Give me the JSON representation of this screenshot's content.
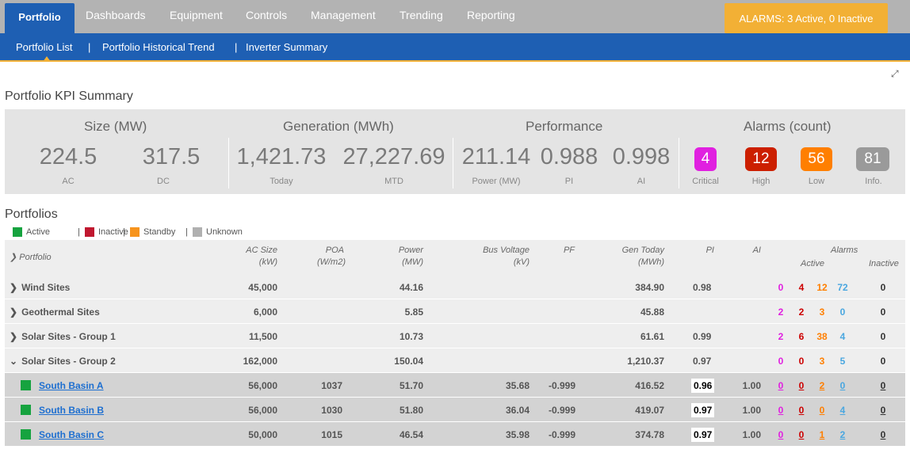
{
  "nav": {
    "tabs": [
      "Portfolio",
      "Dashboards",
      "Equipment",
      "Controls",
      "Management",
      "Trending",
      "Reporting"
    ],
    "alarms": "ALARMS: 3 Active, 0 Inactive"
  },
  "subnav": {
    "items": [
      "Portfolio List",
      "Portfolio Historical Trend",
      "Inverter Summary"
    ],
    "separator": "|"
  },
  "kpi": {
    "title": "Portfolio KPI Summary",
    "groups": {
      "size": "Size (MW)",
      "generation": "Generation (MWh)",
      "performance": "Performance",
      "alarms": "Alarms (count)"
    },
    "values": [
      {
        "value": "224.5",
        "label": "AC"
      },
      {
        "value": "317.5",
        "label": "DC"
      },
      {
        "value": "1,421.73",
        "label": "Today"
      },
      {
        "value": "27,227.69",
        "label": "MTD"
      },
      {
        "value": "211.14",
        "label": "Power (MW)"
      },
      {
        "value": "0.988",
        "label": "PI"
      },
      {
        "value": "0.998",
        "label": "AI"
      }
    ],
    "alarms": [
      {
        "value": "4",
        "label": "Critical",
        "color": "#e020e0"
      },
      {
        "value": "12",
        "label": "High",
        "color": "#cc1f00"
      },
      {
        "value": "56",
        "label": "Low",
        "color": "#ff7f00"
      },
      {
        "value": "81",
        "label": "Info.",
        "color": "#9a9a9a"
      }
    ]
  },
  "portfolios": {
    "title": "Portfolios",
    "legend": [
      {
        "label": "Active",
        "color": "#16a33f"
      },
      {
        "label": "Inactive",
        "color": "#c0172f"
      },
      {
        "label": "Standby",
        "color": "#f7941d"
      },
      {
        "label": "Unknown",
        "color": "#b0b0b0"
      }
    ],
    "legend_sep": "|",
    "headers": {
      "portfolio": "Portfolio",
      "ac_size": "AC Size",
      "ac_size_unit": "(kW)",
      "poa": "POA",
      "poa_unit": "(W/m2)",
      "power": "Power",
      "power_unit": "(MW)",
      "bus_voltage": "Bus Voltage",
      "bus_voltage_unit": "(kV)",
      "pf": "PF",
      "gen_today": "Gen Today",
      "gen_today_unit": "(MWh)",
      "pi": "PI",
      "ai": "AI",
      "alarms": "Alarms",
      "active": "Active",
      "inactive": "Inactive"
    },
    "rows": [
      {
        "name": "Wind Sites",
        "ac": "45,000",
        "poa": "",
        "power": "44.16",
        "bv": "",
        "pf": "",
        "gen": "384.90",
        "pi": "0.98",
        "ai": "",
        "crit": "0",
        "high": "4",
        "low": "12",
        "info": "72",
        "inactive": "0"
      },
      {
        "name": "Geothermal Sites",
        "ac": "6,000",
        "poa": "",
        "power": "5.85",
        "bv": "",
        "pf": "",
        "gen": "45.88",
        "pi": "",
        "ai": "",
        "crit": "2",
        "high": "2",
        "low": "3",
        "info": "0",
        "inactive": "0"
      },
      {
        "name": "Solar Sites - Group 1",
        "ac": "11,500",
        "poa": "",
        "power": "10.73",
        "bv": "",
        "pf": "",
        "gen": "61.61",
        "pi": "0.99",
        "ai": "",
        "crit": "2",
        "high": "6",
        "low": "38",
        "info": "4",
        "inactive": "0"
      },
      {
        "name": "Solar Sites - Group 2",
        "ac": "162,000",
        "poa": "",
        "power": "150.04",
        "bv": "",
        "pf": "",
        "gen": "1,210.37",
        "pi": "0.97",
        "ai": "",
        "crit": "0",
        "high": "0",
        "low": "3",
        "info": "5",
        "inactive": "0"
      },
      {
        "name": "South Basin A",
        "ac": "56,000",
        "poa": "1037",
        "power": "51.70",
        "bv": "35.68",
        "pf": "-0.999",
        "gen": "416.52",
        "pi": "0.96",
        "ai": "1.00",
        "crit": "0",
        "high": "0",
        "low": "2",
        "info": "0",
        "inactive": "0"
      },
      {
        "name": "South Basin B",
        "ac": "56,000",
        "poa": "1030",
        "power": "51.80",
        "bv": "36.04",
        "pf": "-0.999",
        "gen": "419.07",
        "pi": "0.97",
        "ai": "1.00",
        "crit": "0",
        "high": "0",
        "low": "0",
        "info": "4",
        "inactive": "0"
      },
      {
        "name": "South Basin C",
        "ac": "50,000",
        "poa": "1015",
        "power": "46.54",
        "bv": "35.98",
        "pf": "-0.999",
        "gen": "374.78",
        "pi": "0.97",
        "ai": "1.00",
        "crit": "0",
        "high": "0",
        "low": "1",
        "info": "2",
        "inactive": "0"
      }
    ]
  }
}
